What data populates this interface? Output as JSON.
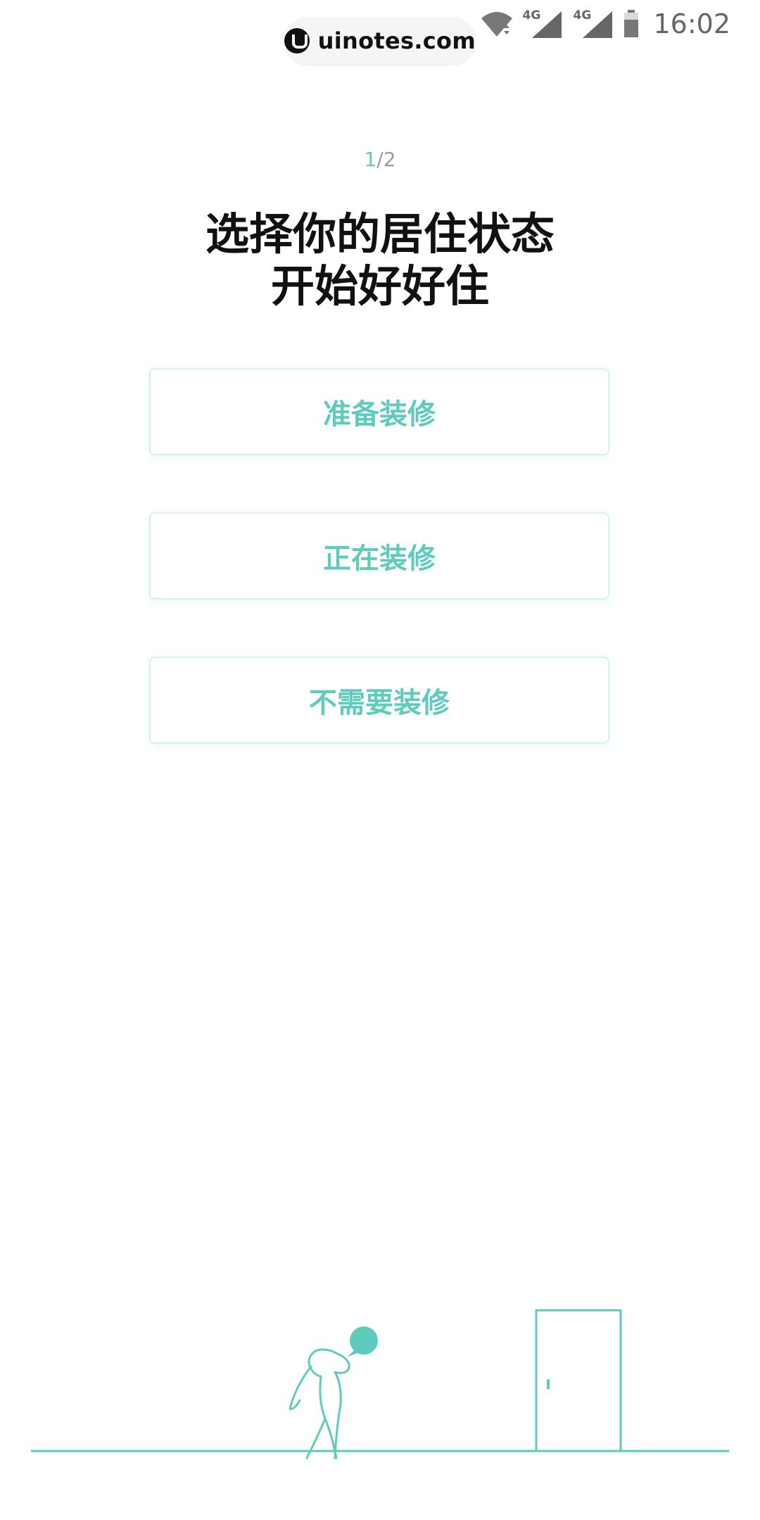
{
  "status_bar": {
    "watermark_text": "uinotes.com",
    "sim1_label": "4G",
    "sim2_label": "4G",
    "time": "16:02"
  },
  "progress": {
    "current": "1",
    "separator_total": "/2"
  },
  "title": {
    "line1": "选择你的居住状态",
    "line2": "开始好好住"
  },
  "options": [
    {
      "label": "准备装修"
    },
    {
      "label": "正在装修"
    },
    {
      "label": "不需要装修"
    }
  ],
  "colors": {
    "accent": "#5ecbbd",
    "title": "#111111",
    "muted": "#9a9a9a"
  },
  "icons": {
    "wifi": "wifi-icon",
    "signal": "signal-icon",
    "battery": "battery-icon",
    "person": "person-illustration",
    "door": "door-illustration",
    "speech": "speech-bubble-icon"
  }
}
